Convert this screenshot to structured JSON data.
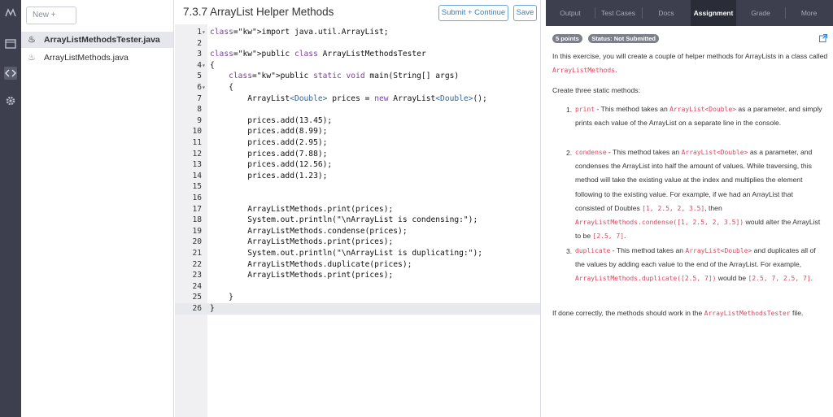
{
  "rail": {
    "icons": [
      "logo-icon",
      "folder-icon",
      "code-icon",
      "settings-icon"
    ]
  },
  "files": {
    "new_label": "New +",
    "items": [
      {
        "name": "ArrayListMethodsTester.java"
      },
      {
        "name": "ArrayListMethods.java"
      }
    ]
  },
  "editor": {
    "title": "7.3.7 ArrayList Helper Methods",
    "submit_label": "Submit + Continue",
    "save_label": "Save",
    "lines": [
      {
        "n": "1",
        "fold": "▾",
        "text": "import java.util.ArrayList;"
      },
      {
        "n": "2",
        "fold": "",
        "text": ""
      },
      {
        "n": "3",
        "fold": "",
        "text": "public class ArrayListMethodsTester"
      },
      {
        "n": "4",
        "fold": "▾",
        "text": "{"
      },
      {
        "n": "5",
        "fold": "",
        "text": "    public static void main(String[] args)"
      },
      {
        "n": "6",
        "fold": "▾",
        "text": "    {"
      },
      {
        "n": "7",
        "fold": "",
        "text": "        ArrayList<Double> prices = new ArrayList<Double>();"
      },
      {
        "n": "8",
        "fold": "",
        "text": ""
      },
      {
        "n": "9",
        "fold": "",
        "text": "        prices.add(13.45);"
      },
      {
        "n": "10",
        "fold": "",
        "text": "        prices.add(8.99);"
      },
      {
        "n": "11",
        "fold": "",
        "text": "        prices.add(2.95);"
      },
      {
        "n": "12",
        "fold": "",
        "text": "        prices.add(7.88);"
      },
      {
        "n": "13",
        "fold": "",
        "text": "        prices.add(12.56);"
      },
      {
        "n": "14",
        "fold": "",
        "text": "        prices.add(1.23);"
      },
      {
        "n": "15",
        "fold": "",
        "text": ""
      },
      {
        "n": "16",
        "fold": "",
        "text": ""
      },
      {
        "n": "17",
        "fold": "",
        "text": "        ArrayListMethods.print(prices);"
      },
      {
        "n": "18",
        "fold": "",
        "text": "        System.out.println(\"\\nArrayList is condensing:\");"
      },
      {
        "n": "19",
        "fold": "",
        "text": "        ArrayListMethods.condense(prices);"
      },
      {
        "n": "20",
        "fold": "",
        "text": "        ArrayListMethods.print(prices);"
      },
      {
        "n": "21",
        "fold": "",
        "text": "        System.out.println(\"\\nArrayList is duplicating:\");"
      },
      {
        "n": "22",
        "fold": "",
        "text": "        ArrayListMethods.duplicate(prices);"
      },
      {
        "n": "23",
        "fold": "",
        "text": "        ArrayListMethods.print(prices);"
      },
      {
        "n": "24",
        "fold": "",
        "text": ""
      },
      {
        "n": "25",
        "fold": "",
        "text": "    }"
      },
      {
        "n": "26",
        "fold": "",
        "text": "}"
      }
    ]
  },
  "right": {
    "tabs": [
      "Output",
      "Test Cases",
      "Docs",
      "Assignment",
      "Grade",
      "More"
    ],
    "active_tab": "Assignment",
    "badge_points": "5 points",
    "badge_status": "Status: Not Submitted",
    "intro_1": "In this exercise, you will create a couple of helper methods for ArrayLists in a class called ",
    "intro_code": "ArrayListMethods",
    "intro_2": ".",
    "create_text": "Create three static methods:",
    "item1": {
      "num": "1.",
      "code": "print",
      "t1": " - This method takes an ",
      "code2": "ArrayList<Double>",
      "t2": " as a parameter, and simply prints each value of the ArrayList on a separate line in the console."
    },
    "item2": {
      "num": "2.",
      "code": "condense",
      "t1": " - This method takes an ",
      "code2": "ArrayList<Double>",
      "t2": " as a parameter, and condenses the ArrayList into half the amount of values. While traversing, this method will take the existing value at the index and multiplies the element following to the existing value. For example, if we had an ArrayList that consisted of Doubles ",
      "code3": "[1, 2.5, 2, 3.5]",
      "t3": ", then ",
      "code4": "ArrayListMethods.condense([1, 2.5, 2, 3.5])",
      "t4": " would alter the ArrayList to be ",
      "code5": "[2.5, 7]",
      "t5": "."
    },
    "item3": {
      "num": "3.",
      "code": "duplicate",
      "t1": " - This method takes an ",
      "code2": "ArrayList<Double>",
      "t2": " and duplicates all of the values by adding each value to the end of the ArrayList. For example, ",
      "code3": "ArrayListMethods.duplicate([2.5, 7])",
      "t3": " would be ",
      "code4": "[2.5, 7, 2.5, 7]",
      "t4": "."
    },
    "outro_1": "If done correctly, the methods should work in the ",
    "outro_code": "ArrayListMethodsTester",
    "outro_2": " file."
  },
  "colors": {
    "rail": "#3d3f4e",
    "accent": "#3a7fc1",
    "code_inline": "#d9485f",
    "keyword": "#7a3e9d"
  }
}
